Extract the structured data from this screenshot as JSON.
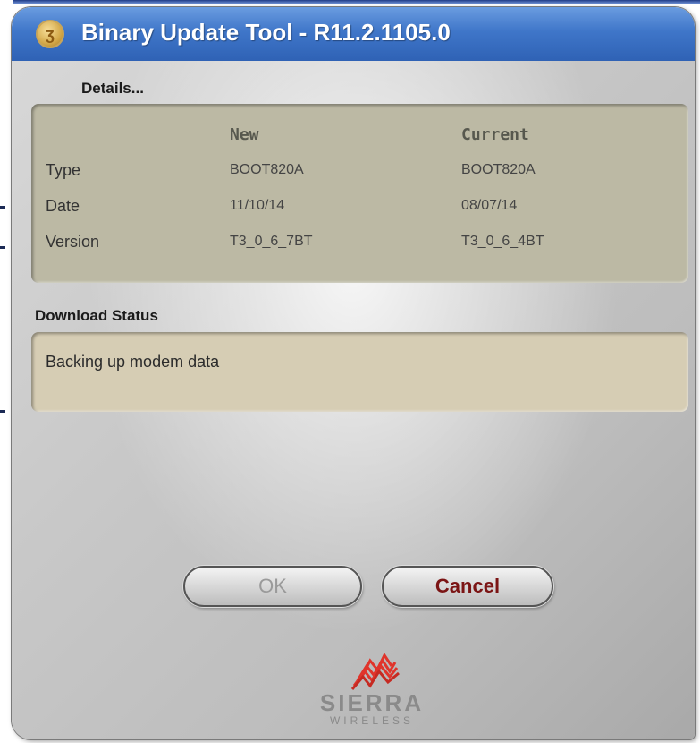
{
  "window": {
    "title": "Binary Update Tool - R11.2.1105.0",
    "icon": "sierra-app-icon"
  },
  "details": {
    "heading": "Details...",
    "columns": [
      "New",
      "Current"
    ],
    "rows": [
      {
        "label": "Type",
        "new": "BOOT820A",
        "current": "BOOT820A"
      },
      {
        "label": "Date",
        "new": "11/10/14",
        "current": "08/07/14"
      },
      {
        "label": "Version",
        "new": "T3_0_6_7BT",
        "current": "T3_0_6_4BT"
      }
    ]
  },
  "download": {
    "heading": "Download Status",
    "status_text": "Backing up modem data"
  },
  "buttons": {
    "ok_label": "OK",
    "cancel_label": "Cancel"
  },
  "logo": {
    "line1": "SIERRA",
    "line2": "WIRELESS"
  },
  "colors": {
    "titlebar": "#3f76c9",
    "panel": "#bcb9a4",
    "status_panel": "#d6cdb4",
    "cancel_text": "#7b1414",
    "logo_red": "#e0342b"
  }
}
